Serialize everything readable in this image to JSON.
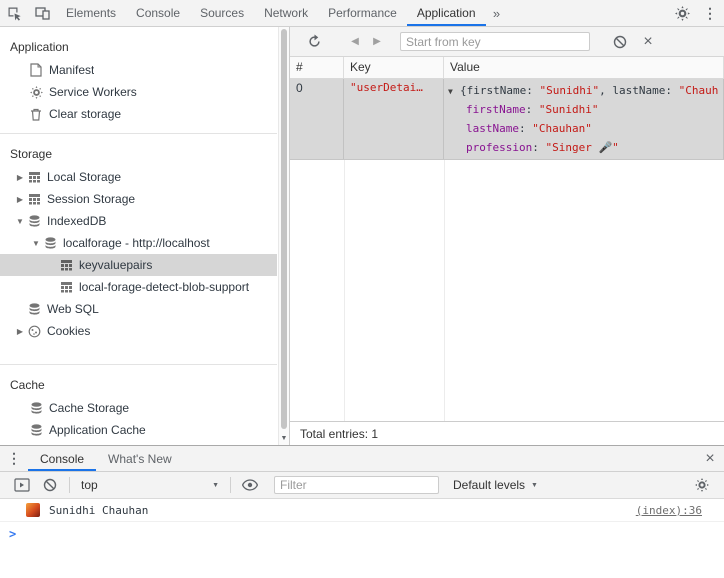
{
  "colors": {
    "accent_blue": "#1a73e8",
    "string_red": "#c41a16",
    "property_purple": "#881391",
    "selection_gray": "#d6d6d6"
  },
  "icons": {
    "overflow": "»",
    "collapsed": "▶",
    "expanded": "▼",
    "back": "◀",
    "forward": "▶",
    "close": "×",
    "dropdown_arrow": "▼",
    "prompt": ">",
    "scroll_down": "▼",
    "kebab": "⋮"
  },
  "tabbar": {
    "tabs": [
      {
        "label": "Elements"
      },
      {
        "label": "Console"
      },
      {
        "label": "Sources"
      },
      {
        "label": "Network"
      },
      {
        "label": "Performance"
      },
      {
        "label": "Application"
      }
    ],
    "selected": "Application"
  },
  "sidebar": {
    "app_section": {
      "title": "Application",
      "items": [
        {
          "label": "Manifest"
        },
        {
          "label": "Service Workers"
        },
        {
          "label": "Clear storage"
        }
      ]
    },
    "storage_section": {
      "title": "Storage",
      "local_storage": "Local Storage",
      "session_storage": "Session Storage",
      "indexeddb": "IndexedDB",
      "localforage": "localforage - http://localhost",
      "keyvaluepairs": "keyvaluepairs",
      "blob_support": "local-forage-detect-blob-support",
      "web_sql": "Web SQL",
      "cookies": "Cookies"
    },
    "cache_section": {
      "title": "Cache",
      "cache_storage": "Cache Storage",
      "application_cache": "Application Cache"
    }
  },
  "idb_view": {
    "start_key_placeholder": "Start from key",
    "columns": {
      "index": "#",
      "key": "Key",
      "value": "Value"
    },
    "row": {
      "index": "0",
      "key": "\"userDetai…",
      "colon": ": ",
      "preview_open": "{firstName: ",
      "preview_str1": "\"Sunidhi\"",
      "preview_mid": ", lastName: ",
      "preview_rest": "\"Chauhan\", profession: \"Singer 🎤\"}",
      "props": [
        {
          "name": "firstName",
          "value": "\"Sunidhi\""
        },
        {
          "name": "lastName",
          "value": "\"Chauhan\""
        },
        {
          "name": "profession",
          "value": "\"Singer 🎤\""
        }
      ]
    },
    "total": "Total entries: 1"
  },
  "drawer": {
    "tabs": {
      "console": "Console",
      "whats_new": "What's New"
    },
    "toolbar": {
      "context": "top",
      "filter_placeholder": "Filter",
      "levels": "Default levels"
    },
    "message": {
      "text": "Sunidhi Chauhan",
      "source": "(index):36"
    }
  }
}
